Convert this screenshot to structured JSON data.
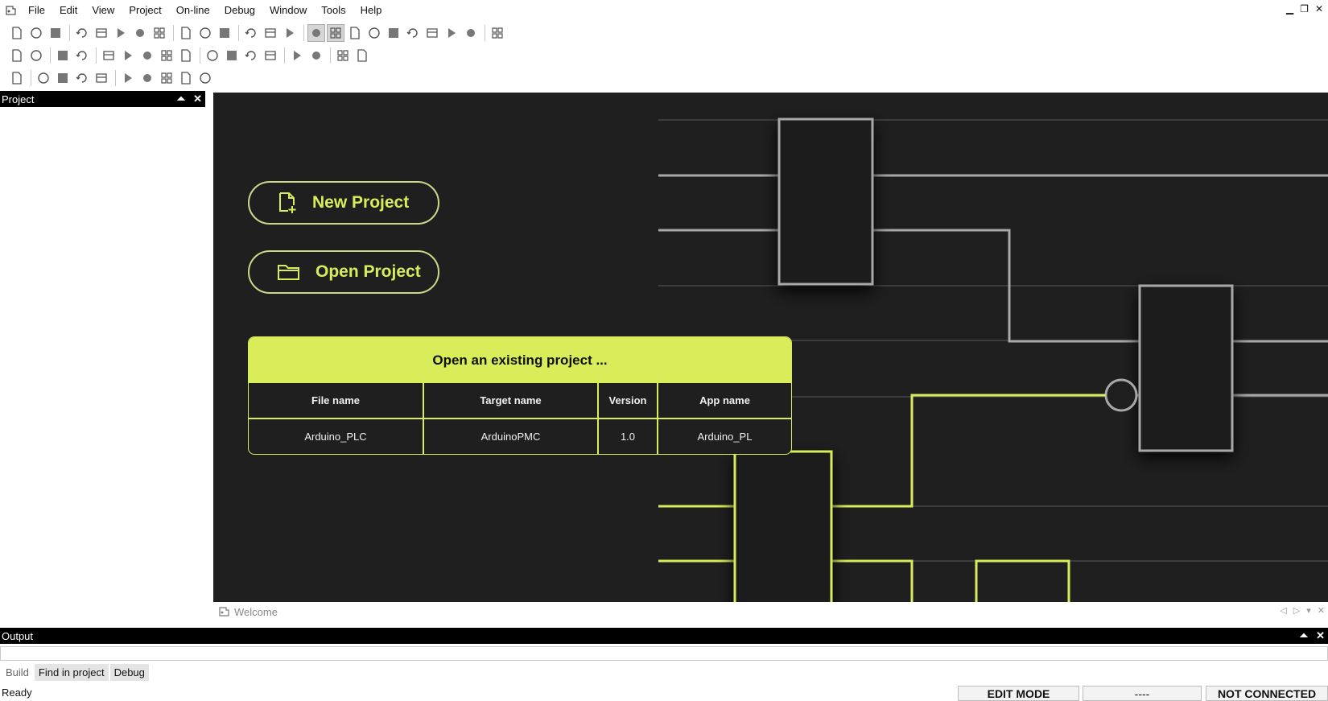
{
  "menu": [
    "File",
    "Edit",
    "View",
    "Project",
    "On-line",
    "Debug",
    "Window",
    "Tools",
    "Help"
  ],
  "toolbars": {
    "row1": [
      "new-file-icon",
      "new-project-icon",
      "save-icon",
      "undo-icon",
      "redo-icon",
      "cut-icon",
      "copy-icon",
      "paste-icon",
      "find-icon",
      "find-next-icon",
      "replace-icon",
      "import-icon",
      "print-icon",
      "print-preview-icon",
      "view-project-icon",
      "view-output-icon",
      "view-library-icon",
      "view-watch-icon",
      "view-properties-icon",
      "view-settings-icon",
      "view-editor-icon",
      "view-text-icon",
      "view-debug-icon",
      "fullscreen-icon"
    ],
    "row2": [
      "compile-icon",
      "build-icon",
      "connect-icon",
      "disconnect-icon",
      "stop-icon",
      "run-icon",
      "step-icon",
      "step-over-icon",
      "flash-icon",
      "monitor-icon",
      "variables-icon",
      "signals-icon",
      "table-icon",
      "grid-icon",
      "grid-alt-icon",
      "back-icon",
      "forward-icon"
    ],
    "row3": [
      "wizard-icon",
      "contact-icon",
      "coil-icon",
      "block-icon",
      "wire-icon",
      "record-icon",
      "circle-icon",
      "play-icon",
      "jump-icon",
      "link-icon"
    ]
  },
  "project_pane": {
    "title": "Project"
  },
  "welcome": {
    "new_project": "New Project",
    "open_project": "Open Project",
    "recent": {
      "title": "Open an existing project ...",
      "columns": [
        "File name",
        "Target name",
        "Version",
        "App name"
      ],
      "rows": [
        [
          "Arduino_PLC",
          "ArduinoPMC",
          "1.0",
          "Arduino_PL"
        ]
      ]
    }
  },
  "doc_tab": {
    "label": "Welcome"
  },
  "output": {
    "title": "Output",
    "tabs": [
      "Build",
      "Find in project",
      "Debug"
    ]
  },
  "status": {
    "left": "Ready",
    "mode": "EDIT MODE",
    "middle": "----",
    "connection": "NOT CONNECTED"
  },
  "colors": {
    "accent": "#d9ec5a",
    "panel_bg": "#1f1f1f",
    "wire_grey": "#a8a8a8"
  }
}
